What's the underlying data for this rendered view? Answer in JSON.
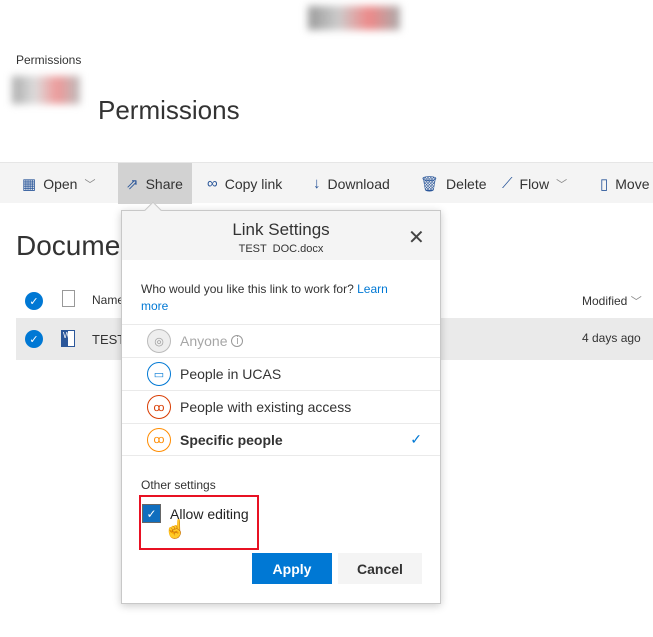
{
  "breadcrumb": "Permissions",
  "page_title": "Permissions",
  "commands": {
    "open": "Open",
    "share": "Share",
    "copy_link": "Copy link",
    "download": "Download",
    "delete": "Delete",
    "flow": "Flow",
    "move": "Move"
  },
  "library_title": "Documents",
  "columns": {
    "name": "Name",
    "modified": "Modified"
  },
  "rows": [
    {
      "name": "TEST DOC.docx",
      "modified": "4 days ago"
    }
  ],
  "dialog": {
    "title": "Link Settings",
    "filename": "TEST  DOC.docx",
    "question": "Who would you like this link to work for?",
    "learn_more": "Learn more",
    "options": [
      {
        "label": "Anyone",
        "disabled": true
      },
      {
        "label": "People in UCAS"
      },
      {
        "label": "People with existing access"
      },
      {
        "label": "Specific people",
        "selected": true
      }
    ],
    "other_settings": "Other settings",
    "allow_editing": "Allow editing",
    "allow_editing_checked": true,
    "apply": "Apply",
    "cancel": "Cancel"
  },
  "colors": {
    "accent": "#0078d4",
    "highlight": "#e81123"
  }
}
